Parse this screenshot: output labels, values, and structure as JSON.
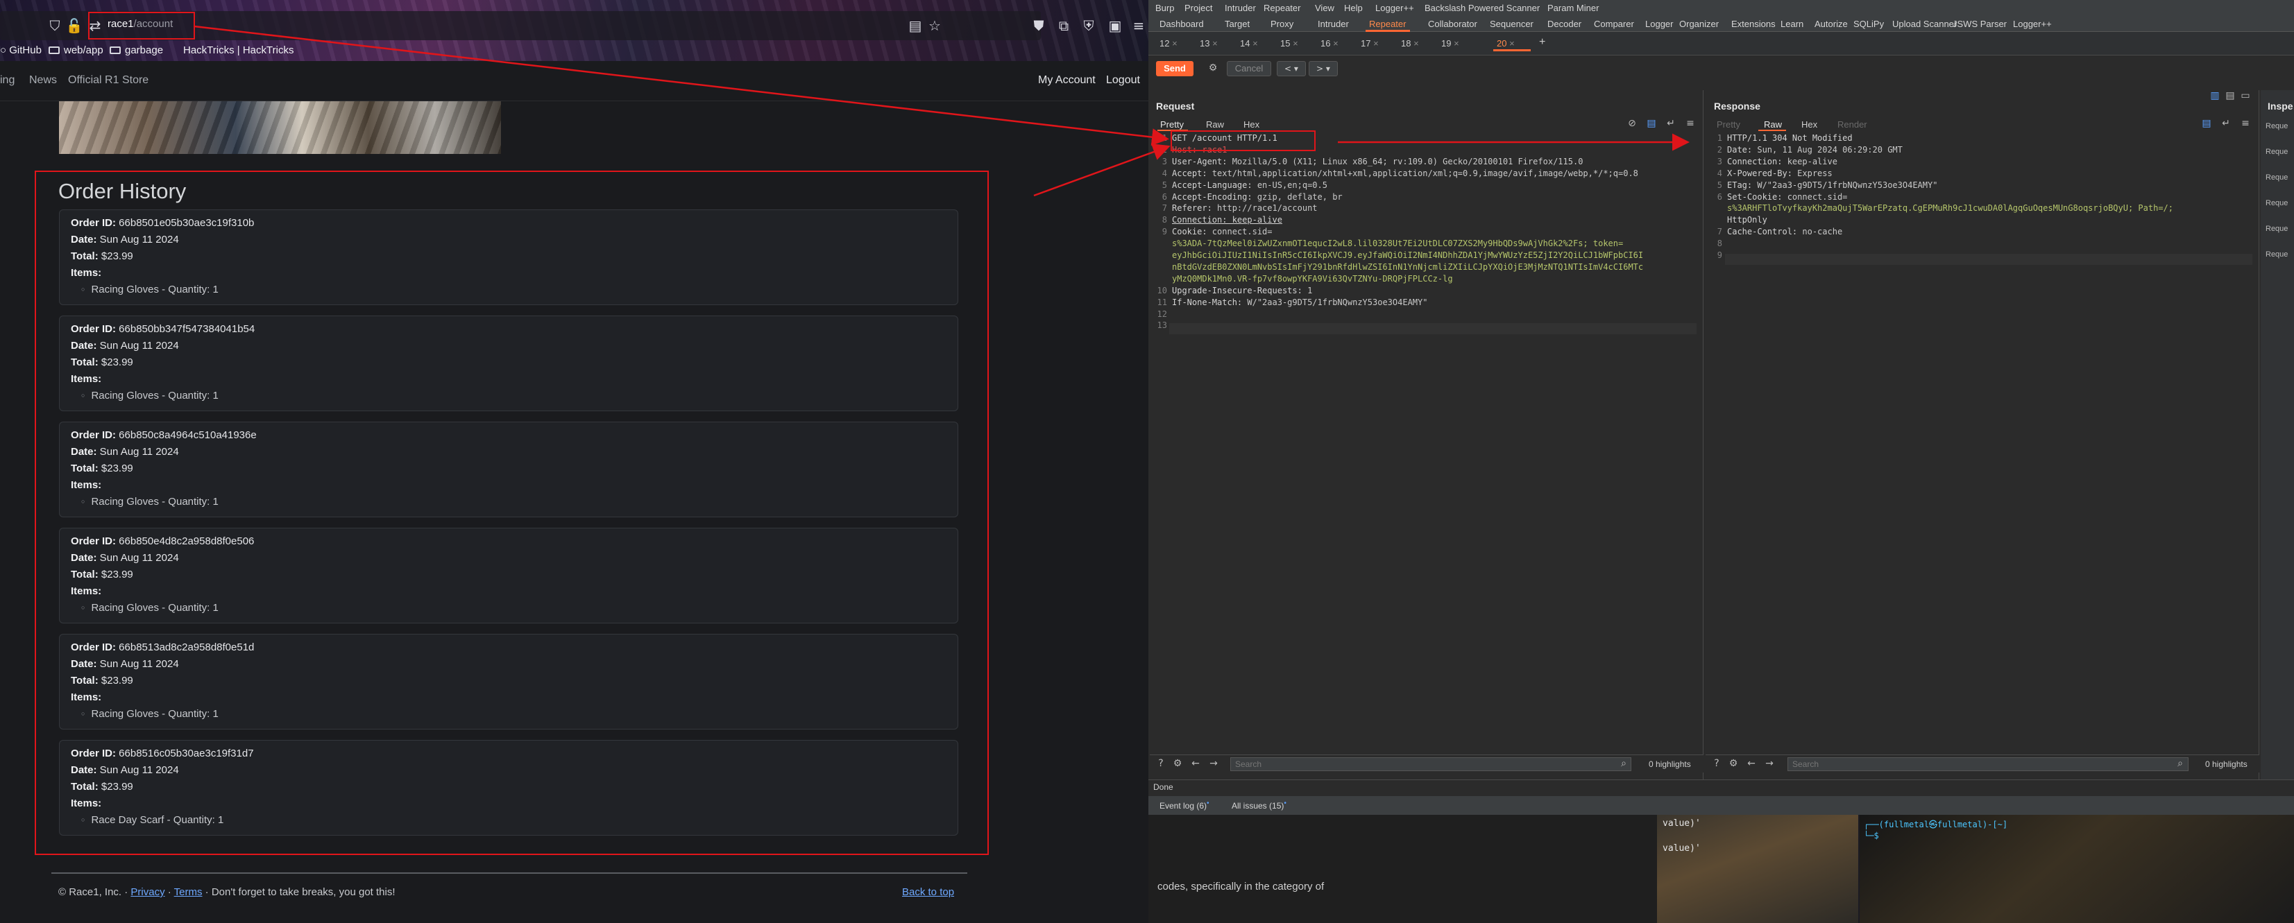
{
  "browser": {
    "url_host": "race1",
    "url_path": "/account",
    "bookmarks": [
      "GitHub",
      "web/app",
      "garbage",
      "HackTricks | HackTricks"
    ]
  },
  "site": {
    "nav_left": [
      "ing",
      "News",
      "Official R1 Store"
    ],
    "nav_right": [
      "My Account",
      "Logout"
    ],
    "order_history_title": "Order History",
    "labels": {
      "order_id": "Order ID:",
      "date": "Date:",
      "total": "Total:",
      "items": "Items:"
    },
    "orders": [
      {
        "id": "66b8501e05b30ae3c19f310b",
        "date": "Sun Aug 11 2024",
        "total": "$23.99",
        "item": "Racing Gloves - Quantity: 1"
      },
      {
        "id": "66b850bb347f547384041b54",
        "date": "Sun Aug 11 2024",
        "total": "$23.99",
        "item": "Racing Gloves - Quantity: 1"
      },
      {
        "id": "66b850c8a4964c510a41936e",
        "date": "Sun Aug 11 2024",
        "total": "$23.99",
        "item": "Racing Gloves - Quantity: 1"
      },
      {
        "id": "66b850e4d8c2a958d8f0e506",
        "date": "Sun Aug 11 2024",
        "total": "$23.99",
        "item": "Racing Gloves - Quantity: 1"
      },
      {
        "id": "66b8513ad8c2a958d8f0e51d",
        "date": "Sun Aug 11 2024",
        "total": "$23.99",
        "item": "Racing Gloves - Quantity: 1"
      },
      {
        "id": "66b8516c05b30ae3c19f31d7",
        "date": "Sun Aug 11 2024",
        "total": "$23.99",
        "item": "Race Day Scarf - Quantity: 1"
      }
    ],
    "footer": {
      "prefix": "© Race1, Inc. · ",
      "privacy": "Privacy",
      "sep": " · ",
      "terms": "Terms",
      "suffix": " · Don't forget to take breaks, you got this!",
      "back_to_top": "Back to top"
    }
  },
  "burp": {
    "menu": [
      "Burp",
      "Project",
      "Intruder",
      "Repeater",
      "View",
      "Help",
      "Logger++",
      "Backslash Powered Scanner",
      "Param Miner"
    ],
    "tool_tabs": [
      "Dashboard",
      "Target",
      "Proxy",
      "Intruder",
      "Repeater",
      "Collaborator",
      "Sequencer",
      "Decoder",
      "Comparer",
      "Logger",
      "Organizer",
      "Extensions",
      "Learn",
      "Autorize",
      "SQLiPy",
      "Upload Scanner",
      "JSWS Parser",
      "Logger++"
    ],
    "active_tool_tab": "Repeater",
    "repeater_tabs": [
      "12",
      "13",
      "14",
      "15",
      "16",
      "17",
      "18",
      "19",
      "20"
    ],
    "active_repeater_tab": "20",
    "tab_close": "×",
    "tab_add": "+",
    "send": "Send",
    "cancel": "Cancel",
    "request": {
      "title": "Request",
      "tabs": [
        "Pretty",
        "Raw",
        "Hex"
      ],
      "active_tab": "Pretty",
      "lines": [
        "GET /account HTTP/1.1",
        "Host: race1",
        "User-Agent: Mozilla/5.0 (X11; Linux x86_64; rv:109.0) Gecko/20100101 Firefox/115.0",
        "Accept: text/html,application/xhtml+xml,application/xml;q=0.9,image/avif,image/webp,*/*;q=0.8",
        "Accept-Language: en-US,en;q=0.5",
        "Accept-Encoding: gzip, deflate, br",
        "Referer: http://race1/account",
        "Connection: keep-alive",
        "Cookie: connect.sid=",
        "s%3ADA-7tQzMeel0iZwUZxnmOT1equcI2wL8.lil0328Ut7Ei2UtDLC07ZXS2My9HbQDs9wAjVhGk2%2Fs; token=",
        "eyJhbGciOiJIUzI1NiIsInR5cCI6IkpXVCJ9.eyJfaWQiOiI2NmI4NDhhZDA1YjMwYWUzYzE5ZjI2Y2QiLCJ1bWFpbCI6I",
        "nBtdGVzdEB0ZXN0LmNvbSIsImFjY291bnRfdHlwZSI6InN1YnNjcmliZXIiLCJpYXQiOjE3MjMzNTQ1NTIsImV4cCI6MTc",
        "yMzQ0MDk1Mn0.VR-fp7vf8owpYKFA9Vi63QvTZNYu-DRQPjFPLCCz-lg",
        "Upgrade-Insecure-Requests: 1",
        "If-None-Match: W/\"2aa3-g9DT5/1frbNQwnzY53oe3O4EAMY\"",
        "",
        ""
      ],
      "line_numbers": [
        "1",
        "2",
        "3",
        "4",
        "5",
        "6",
        "7",
        "8",
        "9",
        "",
        "",
        "",
        "",
        "10",
        "11",
        "12",
        "13"
      ],
      "search_placeholder": "Search",
      "highlights": "0 highlights"
    },
    "response": {
      "title": "Response",
      "tabs": [
        "Pretty",
        "Raw",
        "Hex",
        "Render"
      ],
      "active_tab": "Raw",
      "lines": [
        "HTTP/1.1 304 Not Modified",
        "Date: Sun, 11 Aug 2024 06:29:20 GMT",
        "Connection: keep-alive",
        "X-Powered-By: Express",
        "ETag: W/\"2aa3-g9DT5/1frbNQwnzY53oe3O4EAMY\"",
        "Set-Cookie: connect.sid=",
        "s%3ARHFTloTvyfkayKh2maQujT5WarEPzatq.CgEPMuRh9cJ1cwuDA0lAgqGuOqesMUnG8oqsrjoBQyU; Path=/;",
        "HttpOnly",
        "Cache-Control: no-cache",
        "",
        ""
      ],
      "line_numbers": [
        "1",
        "2",
        "3",
        "4",
        "5",
        "6",
        "",
        "",
        "7",
        "8",
        "9"
      ],
      "search_placeholder": "Search",
      "highlights": "0 highlights"
    },
    "inspector": {
      "title": "Inspe",
      "items": [
        "Reque",
        "Reque",
        "Reque",
        "Reque",
        "Reque",
        "Reque"
      ]
    },
    "status": "Done",
    "bottom_tabs": [
      "Event log (6)",
      "All issues (15)"
    ]
  },
  "background": {
    "doc_text": "codes, specifically in the category of",
    "code_lines": [
      "value)'",
      "value)'"
    ],
    "terminal_prompt": "┌──(fullmetal㉿fullmetal)-[~]",
    "terminal_line2": "└─$"
  },
  "colors": {
    "annotation": "#e0151a",
    "burp_accent": "#ff6633",
    "link": "#6ea8fe"
  }
}
